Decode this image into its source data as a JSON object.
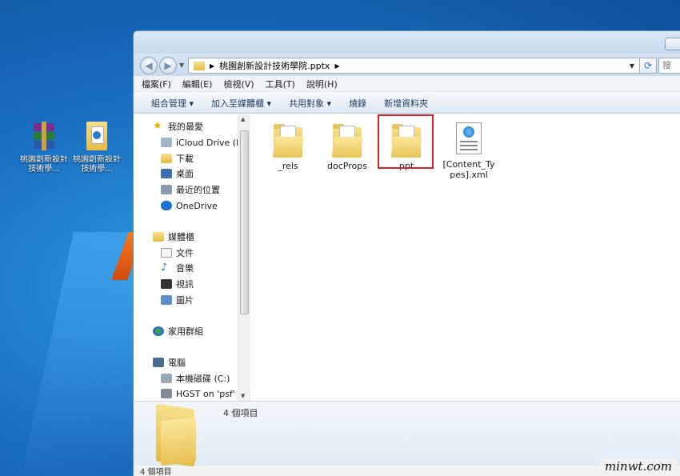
{
  "desktop": {
    "icons": [
      {
        "label": "桃園創新設計技術學..."
      },
      {
        "label": "桃園創新設計技術學..."
      }
    ]
  },
  "window": {
    "address": {
      "path": "桃園創新設計技術學院.pptx"
    },
    "search": {
      "placeholder": "搜"
    },
    "menu": [
      "檔案(F)",
      "編輯(E)",
      "檢視(V)",
      "工具(T)",
      "說明(H)"
    ],
    "toolbar": [
      "組合管理 ▾",
      "加入至媒體櫃 ▾",
      "共用對象 ▾",
      "燒錄",
      "新增資料夾"
    ],
    "nav": {
      "favorites": {
        "label": "我的最愛",
        "items": [
          "iCloud Drive (M",
          "下載",
          "桌面",
          "最近的位置",
          "OneDrive"
        ]
      },
      "libraries": {
        "label": "媒體櫃",
        "items": [
          "文件",
          "音樂",
          "視訊",
          "圖片"
        ]
      },
      "homegroup": {
        "label": "家用群組"
      },
      "computer": {
        "label": "電腦",
        "items": [
          "本機磁碟 (C:)",
          "HGST on 'psf' (V"
        ]
      }
    },
    "files": [
      {
        "name": "_rels",
        "type": "folder"
      },
      {
        "name": "docProps",
        "type": "folder"
      },
      {
        "name": "ppt",
        "type": "folder",
        "selected": true
      },
      {
        "name": "[Content_Types].xml",
        "type": "xml"
      }
    ],
    "details": {
      "count": "4 個項目"
    },
    "status": {
      "text": "4 個項目"
    }
  },
  "watermark": "minwt.com",
  "colors": {
    "selection_border": "#d9232b",
    "desktop_blue": "#1a6fc2"
  }
}
